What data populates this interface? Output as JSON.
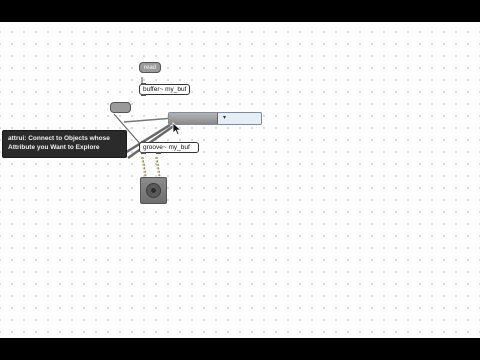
{
  "objects": {
    "read_msg": {
      "label": "read"
    },
    "buffer_obj": {
      "text": "buffer~ my_buf"
    },
    "toggle_msg": {
      "label": ""
    },
    "groove_obj": {
      "text": "groove~ my_buf"
    }
  },
  "attrui": {
    "attribute": "",
    "value": ""
  },
  "tooltip": {
    "text": "attrui: Connect to Objects whose Attribute you Want to Explore"
  },
  "icons": {
    "speaker": "speaker-icon",
    "cursor": "mouse-pointer-icon"
  },
  "colors": {
    "canvas": "#ffffff",
    "wire_audio": "#c9b86a",
    "wire_control": "#555555",
    "tooltip_bg": "#2b2b2b"
  }
}
